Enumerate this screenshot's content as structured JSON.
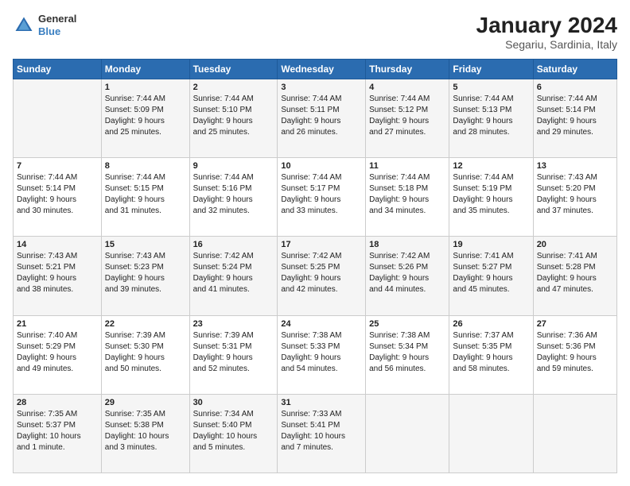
{
  "header": {
    "logo_line1": "General",
    "logo_line2": "Blue",
    "title": "January 2024",
    "subtitle": "Segariu, Sardinia, Italy"
  },
  "days_header": [
    "Sunday",
    "Monday",
    "Tuesday",
    "Wednesday",
    "Thursday",
    "Friday",
    "Saturday"
  ],
  "weeks": [
    [
      {
        "day": "",
        "lines": []
      },
      {
        "day": "1",
        "lines": [
          "Sunrise: 7:44 AM",
          "Sunset: 5:09 PM",
          "Daylight: 9 hours",
          "and 25 minutes."
        ]
      },
      {
        "day": "2",
        "lines": [
          "Sunrise: 7:44 AM",
          "Sunset: 5:10 PM",
          "Daylight: 9 hours",
          "and 25 minutes."
        ]
      },
      {
        "day": "3",
        "lines": [
          "Sunrise: 7:44 AM",
          "Sunset: 5:11 PM",
          "Daylight: 9 hours",
          "and 26 minutes."
        ]
      },
      {
        "day": "4",
        "lines": [
          "Sunrise: 7:44 AM",
          "Sunset: 5:12 PM",
          "Daylight: 9 hours",
          "and 27 minutes."
        ]
      },
      {
        "day": "5",
        "lines": [
          "Sunrise: 7:44 AM",
          "Sunset: 5:13 PM",
          "Daylight: 9 hours",
          "and 28 minutes."
        ]
      },
      {
        "day": "6",
        "lines": [
          "Sunrise: 7:44 AM",
          "Sunset: 5:14 PM",
          "Daylight: 9 hours",
          "and 29 minutes."
        ]
      }
    ],
    [
      {
        "day": "7",
        "lines": [
          "Sunrise: 7:44 AM",
          "Sunset: 5:14 PM",
          "Daylight: 9 hours",
          "and 30 minutes."
        ]
      },
      {
        "day": "8",
        "lines": [
          "Sunrise: 7:44 AM",
          "Sunset: 5:15 PM",
          "Daylight: 9 hours",
          "and 31 minutes."
        ]
      },
      {
        "day": "9",
        "lines": [
          "Sunrise: 7:44 AM",
          "Sunset: 5:16 PM",
          "Daylight: 9 hours",
          "and 32 minutes."
        ]
      },
      {
        "day": "10",
        "lines": [
          "Sunrise: 7:44 AM",
          "Sunset: 5:17 PM",
          "Daylight: 9 hours",
          "and 33 minutes."
        ]
      },
      {
        "day": "11",
        "lines": [
          "Sunrise: 7:44 AM",
          "Sunset: 5:18 PM",
          "Daylight: 9 hours",
          "and 34 minutes."
        ]
      },
      {
        "day": "12",
        "lines": [
          "Sunrise: 7:44 AM",
          "Sunset: 5:19 PM",
          "Daylight: 9 hours",
          "and 35 minutes."
        ]
      },
      {
        "day": "13",
        "lines": [
          "Sunrise: 7:43 AM",
          "Sunset: 5:20 PM",
          "Daylight: 9 hours",
          "and 37 minutes."
        ]
      }
    ],
    [
      {
        "day": "14",
        "lines": [
          "Sunrise: 7:43 AM",
          "Sunset: 5:21 PM",
          "Daylight: 9 hours",
          "and 38 minutes."
        ]
      },
      {
        "day": "15",
        "lines": [
          "Sunrise: 7:43 AM",
          "Sunset: 5:23 PM",
          "Daylight: 9 hours",
          "and 39 minutes."
        ]
      },
      {
        "day": "16",
        "lines": [
          "Sunrise: 7:42 AM",
          "Sunset: 5:24 PM",
          "Daylight: 9 hours",
          "and 41 minutes."
        ]
      },
      {
        "day": "17",
        "lines": [
          "Sunrise: 7:42 AM",
          "Sunset: 5:25 PM",
          "Daylight: 9 hours",
          "and 42 minutes."
        ]
      },
      {
        "day": "18",
        "lines": [
          "Sunrise: 7:42 AM",
          "Sunset: 5:26 PM",
          "Daylight: 9 hours",
          "and 44 minutes."
        ]
      },
      {
        "day": "19",
        "lines": [
          "Sunrise: 7:41 AM",
          "Sunset: 5:27 PM",
          "Daylight: 9 hours",
          "and 45 minutes."
        ]
      },
      {
        "day": "20",
        "lines": [
          "Sunrise: 7:41 AM",
          "Sunset: 5:28 PM",
          "Daylight: 9 hours",
          "and 47 minutes."
        ]
      }
    ],
    [
      {
        "day": "21",
        "lines": [
          "Sunrise: 7:40 AM",
          "Sunset: 5:29 PM",
          "Daylight: 9 hours",
          "and 49 minutes."
        ]
      },
      {
        "day": "22",
        "lines": [
          "Sunrise: 7:39 AM",
          "Sunset: 5:30 PM",
          "Daylight: 9 hours",
          "and 50 minutes."
        ]
      },
      {
        "day": "23",
        "lines": [
          "Sunrise: 7:39 AM",
          "Sunset: 5:31 PM",
          "Daylight: 9 hours",
          "and 52 minutes."
        ]
      },
      {
        "day": "24",
        "lines": [
          "Sunrise: 7:38 AM",
          "Sunset: 5:33 PM",
          "Daylight: 9 hours",
          "and 54 minutes."
        ]
      },
      {
        "day": "25",
        "lines": [
          "Sunrise: 7:38 AM",
          "Sunset: 5:34 PM",
          "Daylight: 9 hours",
          "and 56 minutes."
        ]
      },
      {
        "day": "26",
        "lines": [
          "Sunrise: 7:37 AM",
          "Sunset: 5:35 PM",
          "Daylight: 9 hours",
          "and 58 minutes."
        ]
      },
      {
        "day": "27",
        "lines": [
          "Sunrise: 7:36 AM",
          "Sunset: 5:36 PM",
          "Daylight: 9 hours",
          "and 59 minutes."
        ]
      }
    ],
    [
      {
        "day": "28",
        "lines": [
          "Sunrise: 7:35 AM",
          "Sunset: 5:37 PM",
          "Daylight: 10 hours",
          "and 1 minute."
        ]
      },
      {
        "day": "29",
        "lines": [
          "Sunrise: 7:35 AM",
          "Sunset: 5:38 PM",
          "Daylight: 10 hours",
          "and 3 minutes."
        ]
      },
      {
        "day": "30",
        "lines": [
          "Sunrise: 7:34 AM",
          "Sunset: 5:40 PM",
          "Daylight: 10 hours",
          "and 5 minutes."
        ]
      },
      {
        "day": "31",
        "lines": [
          "Sunrise: 7:33 AM",
          "Sunset: 5:41 PM",
          "Daylight: 10 hours",
          "and 7 minutes."
        ]
      },
      {
        "day": "",
        "lines": []
      },
      {
        "day": "",
        "lines": []
      },
      {
        "day": "",
        "lines": []
      }
    ]
  ]
}
